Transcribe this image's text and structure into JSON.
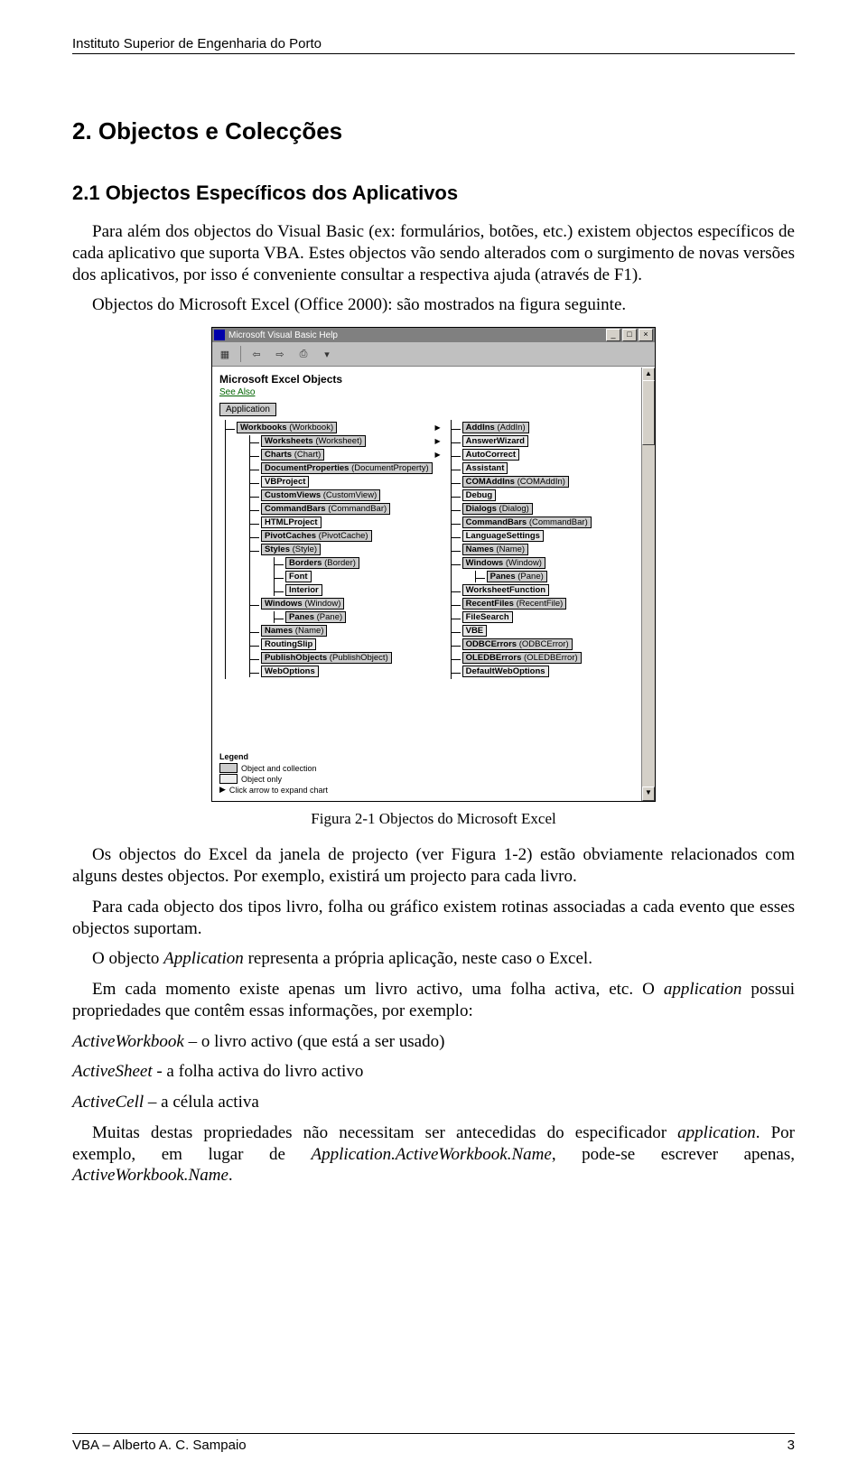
{
  "header": "Instituto Superior de Engenharia do Porto",
  "h1": "2.   Objectos e Colecções",
  "h2": "2.1  Objectos Específicos dos Aplicativos",
  "para1": "Para além dos objectos do Visual Basic (ex: formulários, botões, etc.) existem objectos específicos de cada aplicativo que suporta VBA. Estes objectos vão sendo alterados com o surgimento de novas versões dos aplicativos, por isso é conveniente consultar a respectiva ajuda (através de F1).",
  "para2": "Objectos do Microsoft Excel (Office 2000): são mostrados na figura seguinte.",
  "helpwin": {
    "title": "Microsoft Visual Basic Help",
    "topic": "Microsoft Excel Objects",
    "see_also": "See Also",
    "root": "Application",
    "left": [
      {
        "l": "Workbooks (Workbook)",
        "c": true,
        "exp": true,
        "sub": [
          {
            "l": "Worksheets (Worksheet)",
            "c": true,
            "exp": true
          },
          {
            "l": "Charts (Chart)",
            "c": true,
            "exp": true
          },
          {
            "l": "DocumentProperties (DocumentProperty)",
            "c": true
          },
          {
            "l": "VBProject",
            "c": false
          },
          {
            "l": "CustomViews (CustomView)",
            "c": true
          },
          {
            "l": "CommandBars (CommandBar)",
            "c": true
          },
          {
            "l": "HTMLProject",
            "c": false
          },
          {
            "l": "PivotCaches (PivotCache)",
            "c": true
          },
          {
            "l": "Styles (Style)",
            "c": true,
            "sub": [
              {
                "l": "Borders (Border)",
                "c": true
              },
              {
                "l": "Font",
                "c": false
              },
              {
                "l": "Interior",
                "c": false
              }
            ]
          },
          {
            "l": "Windows (Window)",
            "c": true,
            "sub": [
              {
                "l": "Panes (Pane)",
                "c": true
              }
            ]
          },
          {
            "l": "Names (Name)",
            "c": true
          },
          {
            "l": "RoutingSlip",
            "c": false
          },
          {
            "l": "PublishObjects (PublishObject)",
            "c": true
          },
          {
            "l": "WebOptions",
            "c": false
          }
        ]
      }
    ],
    "right": [
      {
        "l": "AddIns (AddIn)",
        "c": true
      },
      {
        "l": "AnswerWizard",
        "c": false
      },
      {
        "l": "AutoCorrect",
        "c": false
      },
      {
        "l": "Assistant",
        "c": false
      },
      {
        "l": "COMAddIns (COMAddIn)",
        "c": true
      },
      {
        "l": "Debug",
        "c": false
      },
      {
        "l": "Dialogs (Dialog)",
        "c": true
      },
      {
        "l": "CommandBars (CommandBar)",
        "c": true
      },
      {
        "l": "LanguageSettings",
        "c": false
      },
      {
        "l": "Names (Name)",
        "c": true
      },
      {
        "l": "Windows (Window)",
        "c": true,
        "sub": [
          {
            "l": "Panes (Pane)",
            "c": true
          }
        ]
      },
      {
        "l": "WorksheetFunction",
        "c": false
      },
      {
        "l": "RecentFiles (RecentFile)",
        "c": true
      },
      {
        "l": "FileSearch",
        "c": false
      },
      {
        "l": "VBE",
        "c": false
      },
      {
        "l": "ODBCErrors (ODBCError)",
        "c": true
      },
      {
        "l": "OLEDBErrors (OLEDBError)",
        "c": true
      },
      {
        "l": "DefaultWebOptions",
        "c": false
      }
    ],
    "legend": {
      "title": "Legend",
      "coll": "Object and collection",
      "only": "Object only",
      "arrow": "Click arrow to expand chart"
    }
  },
  "caption": "Figura 2-1 Objectos do Microsoft Excel",
  "para3": "Os objectos do Excel da janela de projecto (ver Figura 1-2) estão obviamente relacionados com alguns destes objectos. Por exemplo, existirá um projecto para cada livro.",
  "para4": "Para cada objecto dos tipos livro, folha ou gráfico existem rotinas associadas a cada evento que esses objectos suportam.",
  "para5a": "O objecto ",
  "para5b": "Application",
  "para5c": " representa a própria aplicação, neste caso o Excel.",
  "para6a": "Em cada momento existe apenas um livro activo, uma folha activa, etc. O ",
  "para6b": "application",
  "para6c": " possui propriedades que contêm essas informações, por exemplo:",
  "line_aw_a": "ActiveWorkbook",
  "line_aw_b": " – o livro activo (que está a ser usado)",
  "line_as_a": "ActiveSheet",
  "line_as_b": " - a folha activa do livro activo",
  "line_ac_a": "ActiveCell",
  "line_ac_b": " – a célula activa",
  "para7a": "Muitas destas propriedades não necessitam ser antecedidas do especificador ",
  "para7b": "application",
  "para7c": ". Por exemplo, em lugar de ",
  "para7d": "Application.ActiveWorkbook.Name",
  "para7e": ", pode-se escrever apenas, ",
  "para7f": "ActiveWorkbook.Name",
  "para7g": ".",
  "footer_left": "VBA – Alberto A. C. Sampaio",
  "footer_right": "3"
}
